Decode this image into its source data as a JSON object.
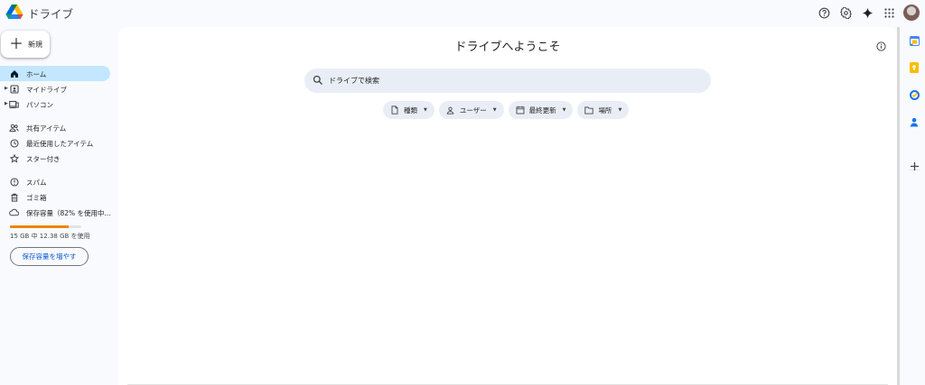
{
  "app": {
    "title": "ドライブ"
  },
  "new_button": {
    "label": "新規"
  },
  "sidebar": {
    "group1": [
      {
        "label": "ホーム",
        "icon": "home-icon",
        "active": true
      },
      {
        "label": "マイドライブ",
        "icon": "my-drive-icon",
        "expandable": true
      },
      {
        "label": "パソコン",
        "icon": "computer-icon",
        "expandable": true
      }
    ],
    "group2": [
      {
        "label": "共有アイテム",
        "icon": "people-icon"
      },
      {
        "label": "最近使用したアイテム",
        "icon": "clock-icon"
      },
      {
        "label": "スター付き",
        "icon": "star-icon"
      }
    ],
    "group3": [
      {
        "label": "スパム",
        "icon": "spam-icon"
      },
      {
        "label": "ゴミ箱",
        "icon": "trash-icon"
      },
      {
        "label": "保存容量（82% を使用中...",
        "icon": "cloud-icon"
      }
    ]
  },
  "storage": {
    "used_fraction": 0.82,
    "text": "15 GB 中 12.38 GB を使用",
    "button_label": "保存容量を増やす",
    "bar_color": "#ea8600"
  },
  "main": {
    "title": "ドライブへようこそ",
    "search_placeholder": "ドライブで検索",
    "chips": [
      {
        "label": "種類",
        "icon": "file-icon"
      },
      {
        "label": "ユーザー",
        "icon": "person-icon"
      },
      {
        "label": "最終更新",
        "icon": "calendar-icon"
      },
      {
        "label": "場所",
        "icon": "folder-icon"
      }
    ]
  },
  "top_icons": [
    "help-icon",
    "settings-icon",
    "gemini-icon",
    "apps-icon",
    "avatar"
  ],
  "side_apps": [
    "calendar-app-icon",
    "keep-app-icon",
    "tasks-app-icon",
    "contacts-app-icon",
    "add-app-icon"
  ],
  "colors": {
    "accent": "#0b57d0",
    "active_nav": "#c2e7ff",
    "search_bg": "#e9eef6"
  }
}
